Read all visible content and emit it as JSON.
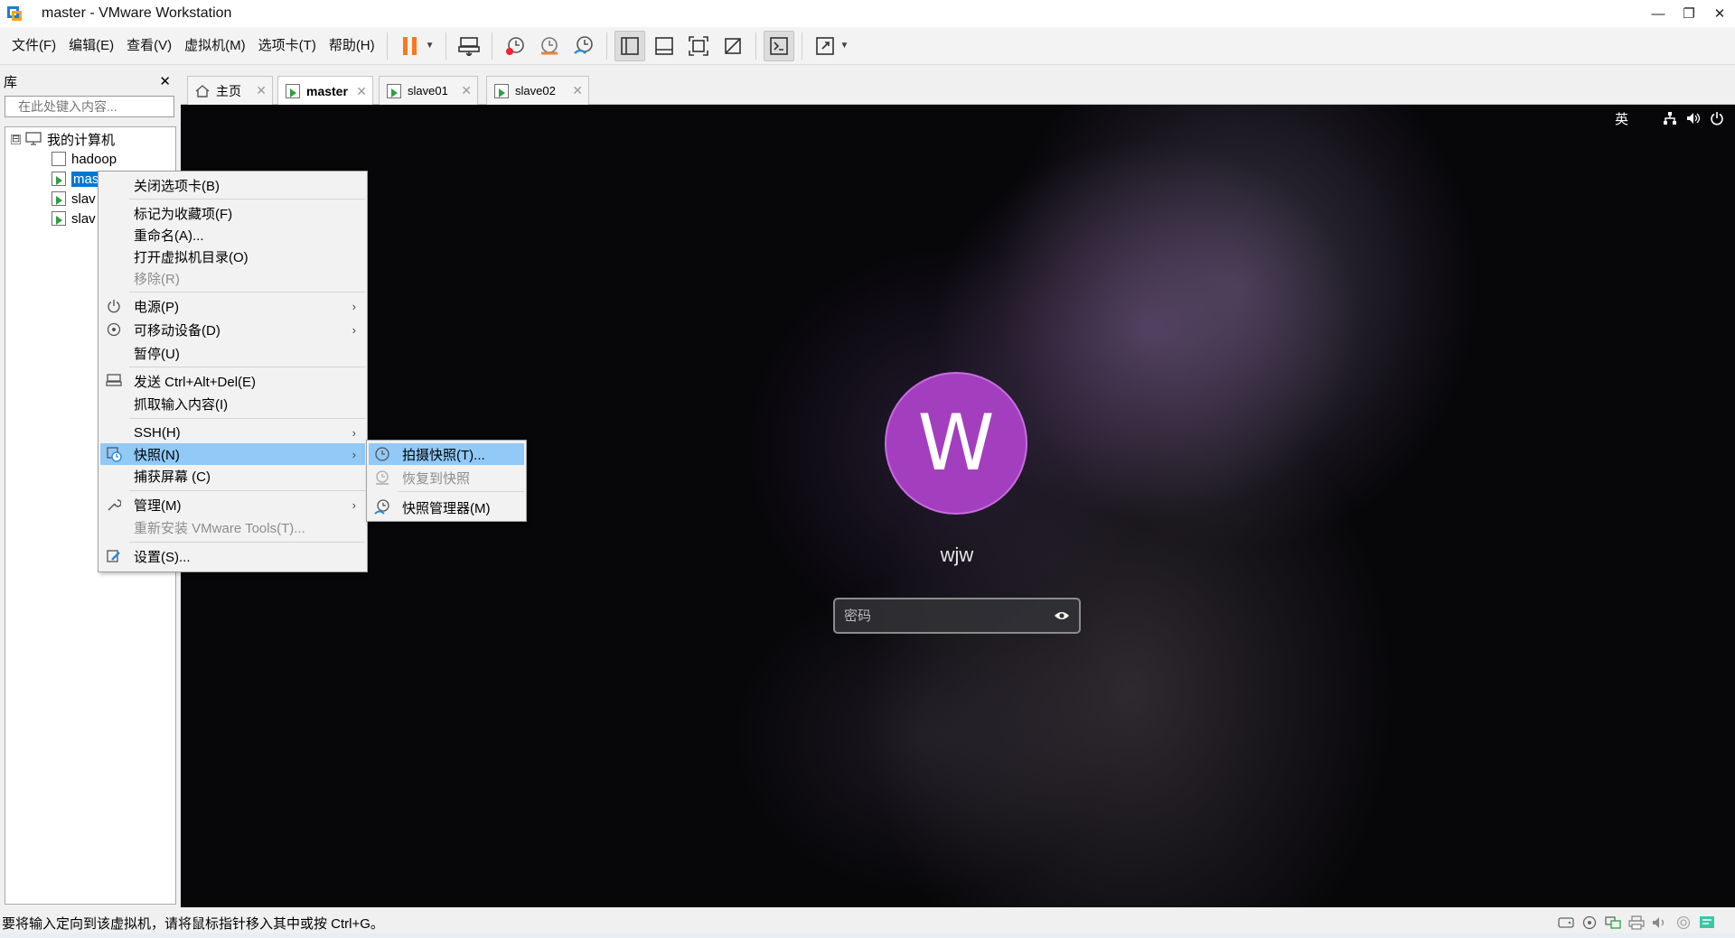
{
  "window": {
    "title": "master - VMware Workstation",
    "minimize": "—",
    "restore": "❐",
    "close": "✕"
  },
  "menubar": {
    "items": [
      "文件(F)",
      "编辑(E)",
      "查看(V)",
      "虚拟机(M)",
      "选项卡(T)",
      "帮助(H)"
    ]
  },
  "toolbar": {
    "pause_color": "#f47920",
    "icons": [
      "pause-icon",
      "send-ctrl-alt-del-icon",
      "take-snapshot-icon",
      "revert-snapshot-icon",
      "snapshot-manager-icon",
      "library-view-icon",
      "thumbnail-bar-icon",
      "fullscreen-icon",
      "unity-icon",
      "console-icon",
      "stretch-icon"
    ]
  },
  "library": {
    "title": "库",
    "close": "✕",
    "search_placeholder": "在此处键入内容...",
    "tree": {
      "root": "我的计算机",
      "expander": "⊟",
      "items": [
        {
          "label": "hadoop",
          "state": "off"
        },
        {
          "label": "mas",
          "state": "running",
          "selected": true
        },
        {
          "label": "slav",
          "state": "running"
        },
        {
          "label": "slav",
          "state": "running"
        }
      ]
    }
  },
  "tabs": [
    {
      "label": "主页",
      "icon": "home-icon",
      "active": false
    },
    {
      "label": "master",
      "icon": "vm-running-icon",
      "active": true
    },
    {
      "label": "slave01",
      "icon": "vm-running-icon",
      "active": false
    },
    {
      "label": "slave02",
      "icon": "vm-running-icon",
      "active": false
    }
  ],
  "tab_close": "✕",
  "vm": {
    "ime_indicator": "英",
    "avatar_letter": "W",
    "avatar_color": "#a33fbf",
    "username": "wjw",
    "password_placeholder": "密码"
  },
  "context_menu": {
    "items": [
      {
        "label": "关闭选项卡(B)"
      },
      {
        "label": "标记为收藏项(F)"
      },
      {
        "label": "重命名(A)..."
      },
      {
        "label": "打开虚拟机目录(O)"
      },
      {
        "label": "移除(R)",
        "disabled": true
      },
      {
        "label": "电源(P)",
        "icon": "power-icon",
        "submenu": true
      },
      {
        "label": "可移动设备(D)",
        "icon": "removable-devices-icon",
        "submenu": true
      },
      {
        "label": "暂停(U)"
      },
      {
        "label": "发送 Ctrl+Alt+Del(E)",
        "icon": "send-ctrl-alt-del-icon"
      },
      {
        "label": "抓取输入内容(I)"
      },
      {
        "label": "SSH(H)",
        "submenu": true
      },
      {
        "label": "快照(N)",
        "icon": "snapshot-icon",
        "submenu": true,
        "highlighted": true
      },
      {
        "label": "捕获屏幕 (C)"
      },
      {
        "label": "管理(M)",
        "icon": "wrench-icon",
        "submenu": true
      },
      {
        "label": "重新安装 VMware Tools(T)...",
        "disabled": true
      },
      {
        "label": "设置(S)...",
        "icon": "settings-icon"
      }
    ],
    "arrow": "›"
  },
  "snapshot_submenu": {
    "items": [
      {
        "label": "拍摄快照(T)...",
        "icon": "take-snapshot-icon",
        "highlighted": true
      },
      {
        "label": "恢复到快照",
        "icon": "revert-snapshot-icon",
        "disabled": true
      },
      {
        "label": "快照管理器(M)",
        "icon": "snapshot-manager-icon"
      }
    ]
  },
  "statusbar": {
    "text": "要将输入定向到该虚拟机，请将鼠标指针移入其中或按 Ctrl+G。",
    "icons": [
      "hard-disk-icon",
      "cd-rom-icon",
      "network-icon",
      "printer-icon",
      "sound-icon",
      "usb-icon",
      "message-icon"
    ]
  }
}
